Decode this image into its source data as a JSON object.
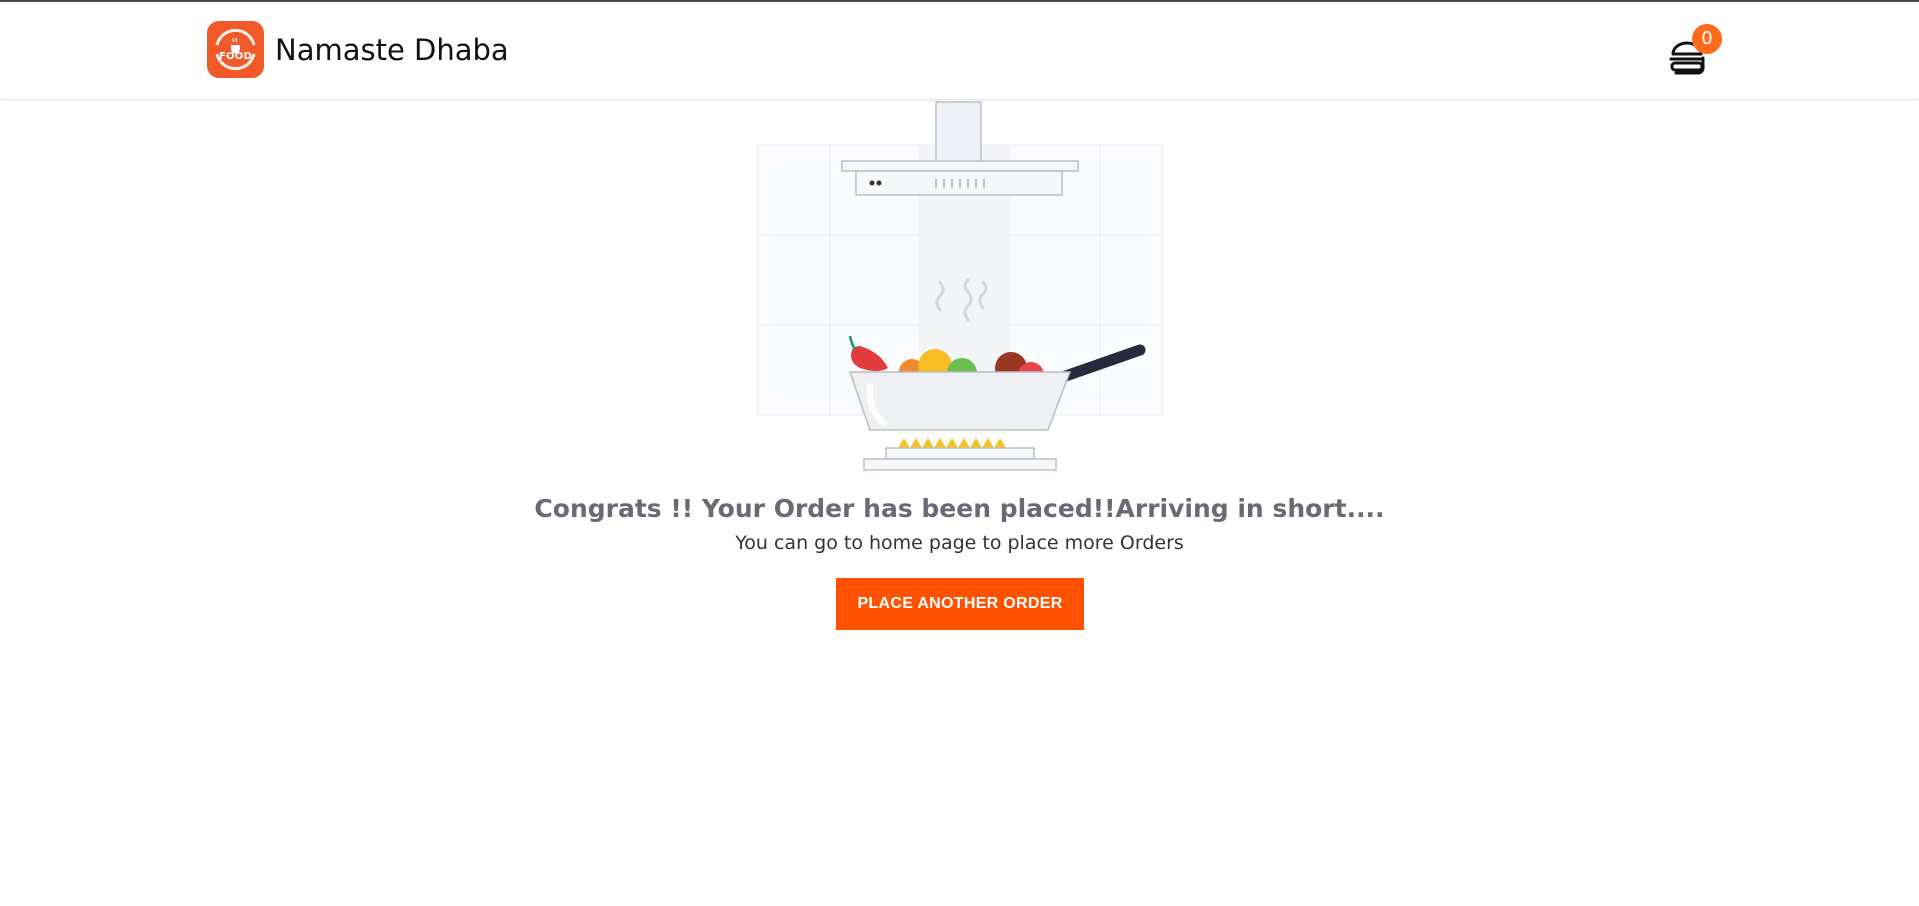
{
  "header": {
    "logo_text": "FOOD",
    "brand_name": "Namaste Dhaba",
    "cart_count": "0"
  },
  "main": {
    "headline": "Congrats !! Your Order has been placed!!Arriving in short....",
    "subline": "You can go to home page to place more Orders",
    "cta_label": "PLACE ANOTHER ORDER"
  },
  "colors": {
    "brand_orange": "#f05a28",
    "button_orange": "#ff5200",
    "badge_orange": "#ff6b1a",
    "headline_gray": "#676b76"
  },
  "icons": [
    "food-logo-icon",
    "cart-icon"
  ]
}
